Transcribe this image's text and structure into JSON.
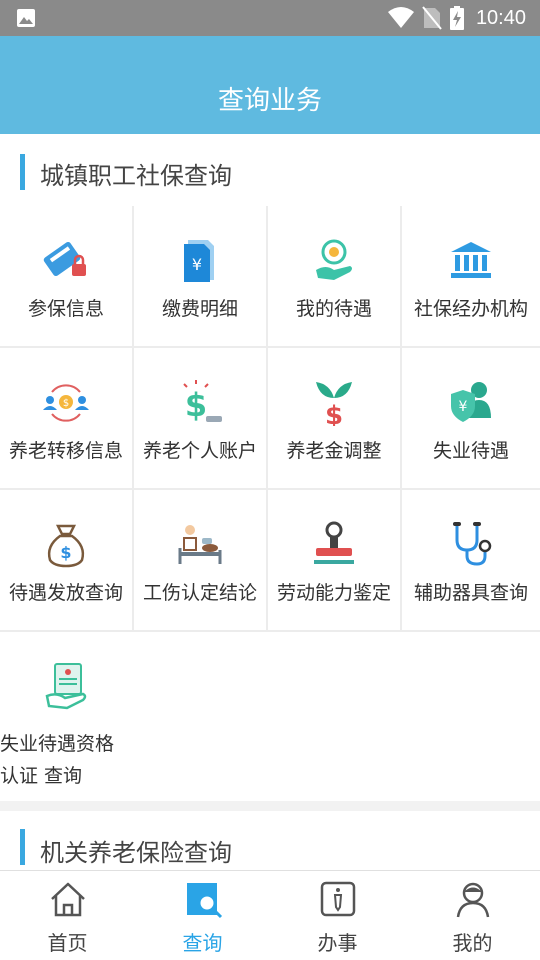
{
  "status_bar": {
    "time": "10:40"
  },
  "header": {
    "title": "查询业务"
  },
  "sections": [
    {
      "title": "城镇职工社保查询"
    },
    {
      "title": "机关养老保险查询"
    }
  ],
  "items": [
    {
      "label": "参保信息",
      "icon": "id-card-lock-icon"
    },
    {
      "label": "缴费明细",
      "icon": "yen-document-icon"
    },
    {
      "label": "我的待遇",
      "icon": "hand-coin-icon"
    },
    {
      "label": "社保经办机构",
      "icon": "bank-building-icon"
    },
    {
      "label": "养老转移信息",
      "icon": "transfer-people-icon"
    },
    {
      "label": "养老个人账户",
      "icon": "dollar-account-icon"
    },
    {
      "label": "养老金调整",
      "icon": "money-plant-icon"
    },
    {
      "label": "失业待遇",
      "icon": "shield-person-icon"
    },
    {
      "label": "待遇发放查询",
      "icon": "money-bag-icon"
    },
    {
      "label": "工伤认定结论",
      "icon": "hospital-bed-icon"
    },
    {
      "label": "劳动能力鉴定",
      "icon": "stamp-icon"
    },
    {
      "label": "辅助器具查询",
      "icon": "stethoscope-icon"
    },
    {
      "label": "失业待遇资格认证 查询",
      "icon": "certificate-hand-icon"
    }
  ],
  "nav": [
    {
      "label": "首页",
      "icon": "home-icon",
      "active": false
    },
    {
      "label": "查询",
      "icon": "search-doc-icon",
      "active": true
    },
    {
      "label": "办事",
      "icon": "tie-card-icon",
      "active": false
    },
    {
      "label": "我的",
      "icon": "user-icon",
      "active": false
    }
  ],
  "colors": {
    "header": "#5fbae0",
    "accent": "#2aa4e6",
    "section_bar": "#3aa8e0"
  }
}
